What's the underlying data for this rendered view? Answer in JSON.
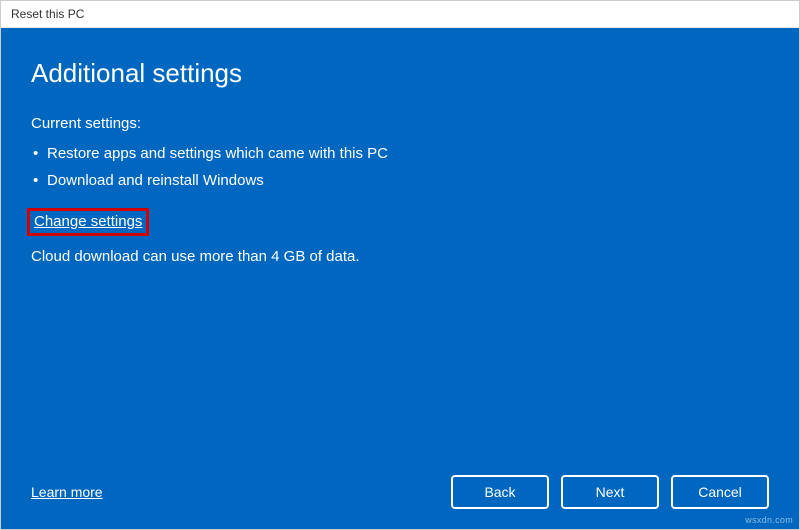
{
  "window": {
    "title": "Reset this PC"
  },
  "main": {
    "heading": "Additional settings",
    "current_label": "Current settings:",
    "bullets": [
      "Restore apps and settings which came with this PC",
      "Download and reinstall Windows"
    ],
    "change_link": "Change settings",
    "note": "Cloud download can use more than 4 GB of data."
  },
  "footer": {
    "learn_more": "Learn more",
    "buttons": {
      "back": "Back",
      "next": "Next",
      "cancel": "Cancel"
    }
  },
  "watermark": "wsxdn.com"
}
